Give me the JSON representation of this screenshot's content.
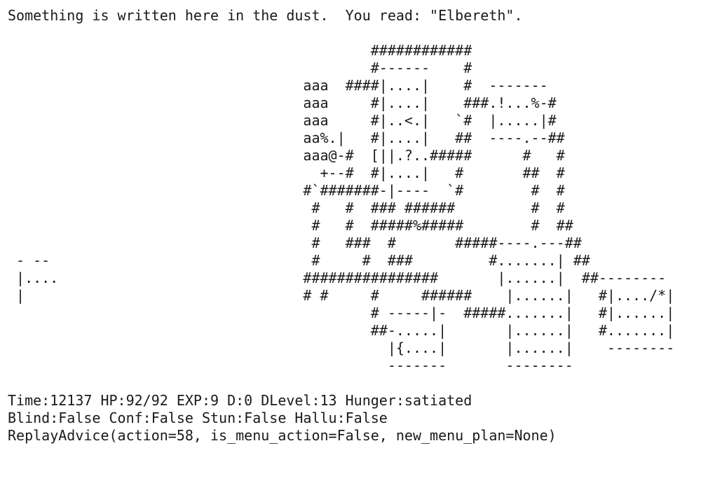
{
  "message": "Something is written here in the dust.  You read: \"Elbereth\".",
  "map": [
    "",
    "                                           ############",
    "                                           #------    #",
    "                                   aaa  ####|....|    #  -------",
    "                                   aaa     #|....|    ###.!...%-#",
    "                                   aaa     #|..<.|   `#  |.....|#",
    "                                   aa%.|   #|....|   ##  ----.--##",
    "                                   aaa@-#  [||.?..#####      #   #",
    "                                     +--#  #|....|   #       ##  #",
    "                                   #`#######-|----  `#        #  #",
    "                                    #   #  ### ######         #  #",
    "                                    #   #  #####%#####        #  ##",
    "                                    #   ###  #       #####----.---##",
    " - --                               #     #  ###         #.......| ##",
    " |....                             ################       |......|  ##--------",
    " |                                 # #     #     ######    |......|   #|..../*|",
    "                                           # -----|-  #####.......|   #|......|",
    "                                           ##-.....|       |......|   #.......|",
    "                                             |{....|       |......|    --------",
    "                                             -------       --------",
    ""
  ],
  "status": {
    "line1": "Time:12137 HP:92/92 EXP:9 D:0 DLevel:13 Hunger:satiated",
    "line2": "Blind:False Conf:False Stun:False Hallu:False",
    "line3": "ReplayAdvice(action=58, is_menu_action=False, new_menu_plan=None)"
  }
}
